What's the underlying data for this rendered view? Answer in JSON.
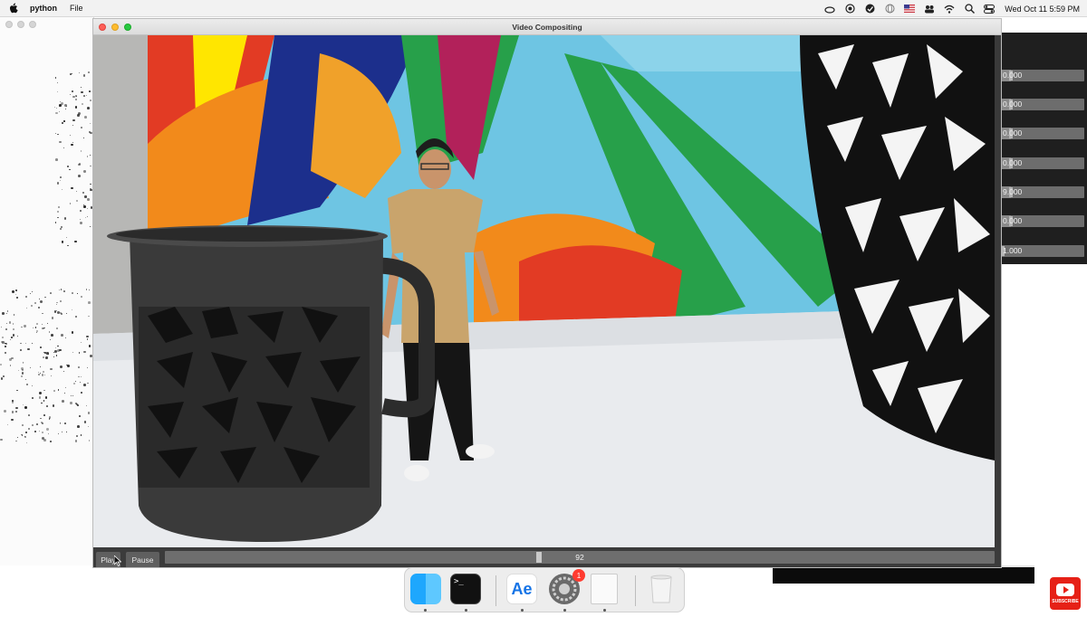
{
  "menubar": {
    "app_name": "python",
    "menu_items": [
      "File"
    ],
    "clock": "Wed Oct 11   5:59 PM"
  },
  "window": {
    "title": "Video Compositing"
  },
  "sliders": [
    {
      "value_text": "0.000",
      "fraction": 0.12
    },
    {
      "value_text": "0.000",
      "fraction": 0.12
    },
    {
      "value_text": "0.000",
      "fraction": 0.12
    },
    {
      "value_text": "0.000",
      "fraction": 0.12
    },
    {
      "value_text": "9.000",
      "fraction": 0.12
    },
    {
      "value_text": "0.000",
      "fraction": 0.12
    },
    {
      "value_text": "1.000",
      "fraction": 0.0
    }
  ],
  "controls": {
    "play_label": "Play",
    "pause_label": "Pause",
    "timeline_value": "92"
  },
  "dock": {
    "items": [
      "finder-icon",
      "terminal-icon",
      "after-effects-icon",
      "system-settings-icon",
      "document-icon",
      "trash-icon"
    ],
    "ae_label": "Ae",
    "terminal_label": ">_",
    "settings_badge": "1"
  },
  "subscribe": {
    "label": "SUBSCRIBE"
  },
  "colors": {
    "wall_blue": "#6ec5e3",
    "wall_green": "#27a04a",
    "wall_orange": "#f28a1b",
    "wall_red": "#e23b24",
    "wall_navy": "#1c2f8c",
    "table": "#e9ebee",
    "mug": "#3a3a3a",
    "shirt": "#c9a46c",
    "pillow": "#111111"
  }
}
